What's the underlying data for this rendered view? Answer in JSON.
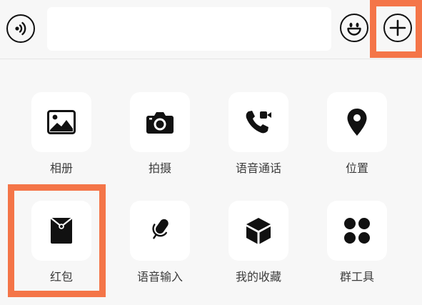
{
  "input_bar": {
    "voice_icon": "voice-wave-icon",
    "emoji_icon": "smiley-face-icon",
    "plus_icon": "plus-circle-icon",
    "text_value": ""
  },
  "panel": {
    "row1": [
      {
        "label": "相册",
        "icon": "photo-album-icon"
      },
      {
        "label": "拍摄",
        "icon": "camera-icon"
      },
      {
        "label": "语音通话",
        "icon": "voice-call-icon"
      },
      {
        "label": "位置",
        "icon": "location-pin-icon"
      }
    ],
    "row2": [
      {
        "label": "红包",
        "icon": "red-packet-icon"
      },
      {
        "label": "语音输入",
        "icon": "microphone-icon"
      },
      {
        "label": "我的收藏",
        "icon": "favorites-cube-icon"
      },
      {
        "label": "群工具",
        "icon": "group-tools-icon"
      }
    ]
  },
  "colors": {
    "highlight": "#f47548",
    "icon": "#111111",
    "tile_bg": "#ffffff",
    "panel_bg": "#f7f7f7"
  }
}
